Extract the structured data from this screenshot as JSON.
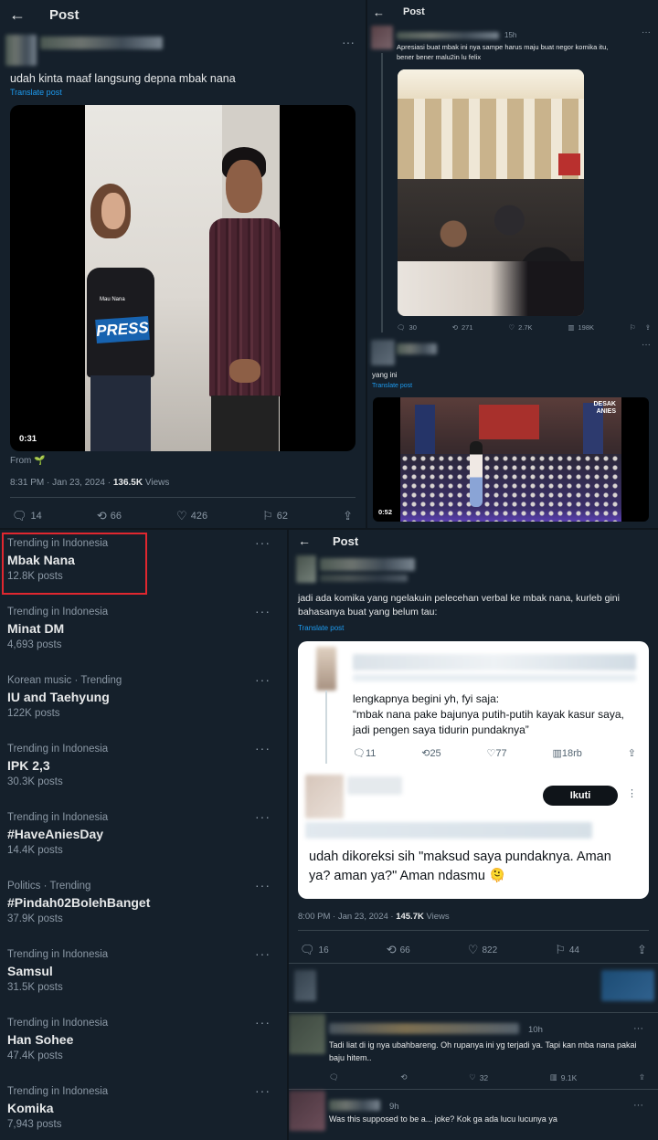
{
  "tl": {
    "header": "Post",
    "text": "udah kinta maaf langsung depna mbak nana",
    "translate": "Translate post",
    "video_time": "0:31",
    "from_label": "From",
    "meta_time": "8:31 PM · Jan 23, 2024 · ",
    "views": "136.5K",
    "views_label": " Views",
    "actions": {
      "reply": "14",
      "retweet": "66",
      "like": "426",
      "bookmark": "62"
    },
    "shirt_brand": "Mau Nana",
    "shirt_text": "PRESS"
  },
  "tr": {
    "header": "Post",
    "age": "15h",
    "text": "Apresiasi buat mbak ini nya sampe harus maju buat negor komika itu, bener bener malu2in lu felix",
    "actions": {
      "reply": "30",
      "retweet": "271",
      "like": "2.7K",
      "views": "198K"
    },
    "reply_text": "yang ini",
    "translate": "Translate post",
    "video_time": "0:52",
    "video_logo": "DESAK ANIES"
  },
  "trends": [
    {
      "ctx": "Trending in Indonesia",
      "name": "Mbak Nana",
      "posts": "12.8K posts"
    },
    {
      "ctx": "Trending in Indonesia",
      "name": "Minat DM",
      "posts": "4,693 posts"
    },
    {
      "ctx": "Korean music · Trending",
      "name": "IU and Taehyung",
      "posts": "122K posts"
    },
    {
      "ctx": "Trending in Indonesia",
      "name": "IPK 2,3",
      "posts": "30.3K posts"
    },
    {
      "ctx": "Trending in Indonesia",
      "name": "#HaveAniesDay",
      "posts": "14.4K posts"
    },
    {
      "ctx": "Politics · Trending",
      "name": "#Pindah02BolehBanget",
      "posts": "37.9K posts"
    },
    {
      "ctx": "Trending in Indonesia",
      "name": "Samsul",
      "posts": "31.5K posts"
    },
    {
      "ctx": "Trending in Indonesia",
      "name": "Han Sohee",
      "posts": "47.4K posts"
    },
    {
      "ctx": "Trending in Indonesia",
      "name": "Komika",
      "posts": "7,943 posts"
    }
  ],
  "br": {
    "header": "Post",
    "text": "jadi ada komika yang ngelakuin pelecehan verbal ke mbak nana, kurleb gini bahasanya buat yang belum tau:",
    "translate": "Translate post",
    "card": {
      "quote": "lengkapnya begini yh, fyi saja:\n“mbak nana pake bajunya putih-putih kayak kasur saya, jadi pengen saya tidurin pundaknya”",
      "actions": {
        "reply": "11",
        "retweet": "25",
        "like": "77",
        "views": "18rb"
      },
      "follow": "Ikuti",
      "reply": "udah dikoreksi sih \"maksud saya pundaknya. Aman ya? aman ya?\" Aman ndasmu 🫠"
    },
    "meta_time": "8:00 PM · Jan 23, 2024 · ",
    "views": "145.7K",
    "views_label": " Views",
    "actions": {
      "reply": "16",
      "retweet": "66",
      "like": "822",
      "bookmark": "44"
    },
    "reply1": {
      "age": "10h",
      "text": "Tadi liat di ig nya ubahbareng. Oh rupanya ini yg terjadi ya. Tapi kan mba nana pakai baju hitem..",
      "like": "32",
      "views": "9.1K"
    },
    "reply2": {
      "age": "9h",
      "text": "Was this supposed to be a... joke? Kok ga ada lucu lucunya ya"
    }
  },
  "colors": {
    "bg": "#15202b",
    "accent": "#1d9bf0",
    "highlight_box": "#e0272f"
  }
}
